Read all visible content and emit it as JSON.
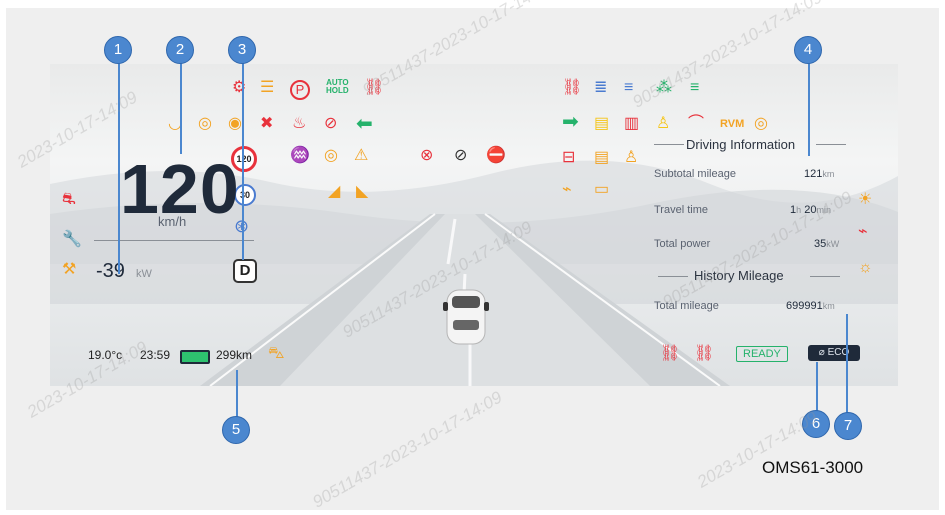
{
  "speed": {
    "value": "120",
    "unit": "km/h"
  },
  "power": {
    "value": "-39",
    "unit": "kW"
  },
  "gear": "D",
  "speed_limit_sign": "120",
  "cruise_sign": "30",
  "auto_hold": {
    "line1": "AUTO",
    "line2": "HOLD"
  },
  "bottom_bar": {
    "temperature": "19.0°c",
    "time": "23:59",
    "range": "299km"
  },
  "driving_info": {
    "title": "Driving Information",
    "rows": [
      {
        "label": "Subtotal mileage",
        "value": "121",
        "unit": "km"
      },
      {
        "label": "Travel time",
        "hours": "1",
        "h_unit": "h",
        "minutes": "20",
        "m_unit": "min"
      },
      {
        "label": "Total power",
        "value": "35",
        "unit": "kW"
      }
    ]
  },
  "history": {
    "title": "History Mileage",
    "label": "Total mileage",
    "value": "699991",
    "unit": "km"
  },
  "status": {
    "ready": "READY",
    "eco": "ECO",
    "rvm": "RVM"
  },
  "model_label": "OMS61-3000",
  "callouts": [
    "1",
    "2",
    "3",
    "4",
    "5",
    "6",
    "7"
  ],
  "watermark": "2023-10-17-14:09",
  "watermark_alt": "90511437-2023-10-17-14:09",
  "colors": {
    "amber": "#f2a324",
    "red": "#e8323c",
    "green": "#25b26b",
    "blue": "#4a7bd0",
    "callout": "#4b87cf"
  },
  "icons": [
    "brake-warning-icon",
    "parking-brake-icon",
    "seatbelt-icon",
    "airbag-icon",
    "turn-left-icon",
    "turn-right-icon",
    "battery-icon",
    "high-beam-icon",
    "low-beam-icon",
    "fog-light-icon",
    "charging-plug-icon",
    "car-ahead-icon"
  ]
}
